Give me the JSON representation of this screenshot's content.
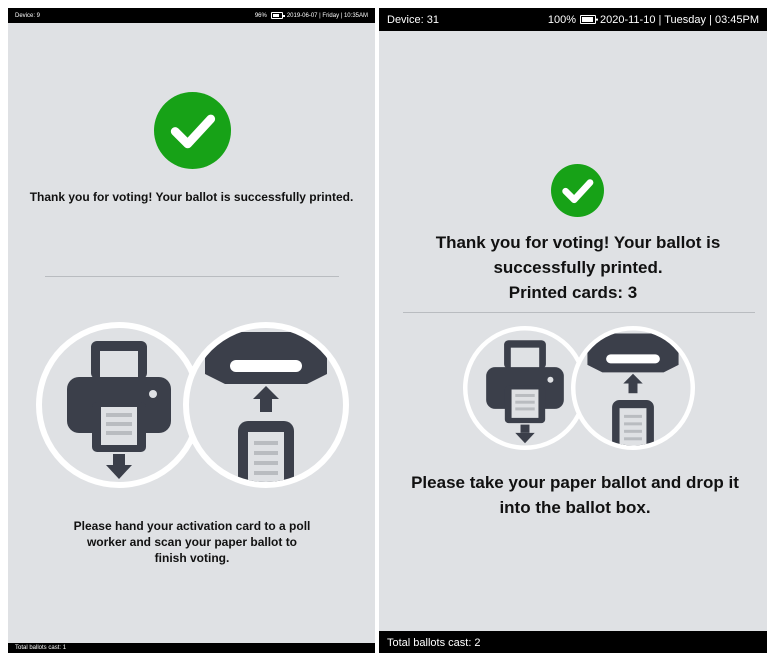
{
  "left": {
    "status": {
      "device": "Device: 9",
      "battery": "96%",
      "datetime": "2019-06-07 | Friday | 10:35AM"
    },
    "message": "Thank you for voting! Your ballot is successfully printed.",
    "instruction": "Please hand your activation card to a poll worker and scan your paper ballot to finish voting.",
    "footer": "Total ballots cast: 1"
  },
  "right": {
    "status": {
      "device": "Device: 31",
      "battery": "100%",
      "datetime": "2020-11-10 | Tuesday | 03:45PM"
    },
    "message": "Thank you for voting! Your ballot is successfully printed.",
    "printed_cards": "Printed cards: 3",
    "instruction": "Please take your paper ballot and drop it into the ballot box.",
    "footer": "Total ballots cast: 2"
  },
  "colors": {
    "success": "#17a217",
    "background": "#dfe1e4",
    "icon": "#3b3f4a",
    "bar": "#000000"
  },
  "icons": [
    "checkmark-icon",
    "printer-icon",
    "ballot-box-icon"
  ]
}
